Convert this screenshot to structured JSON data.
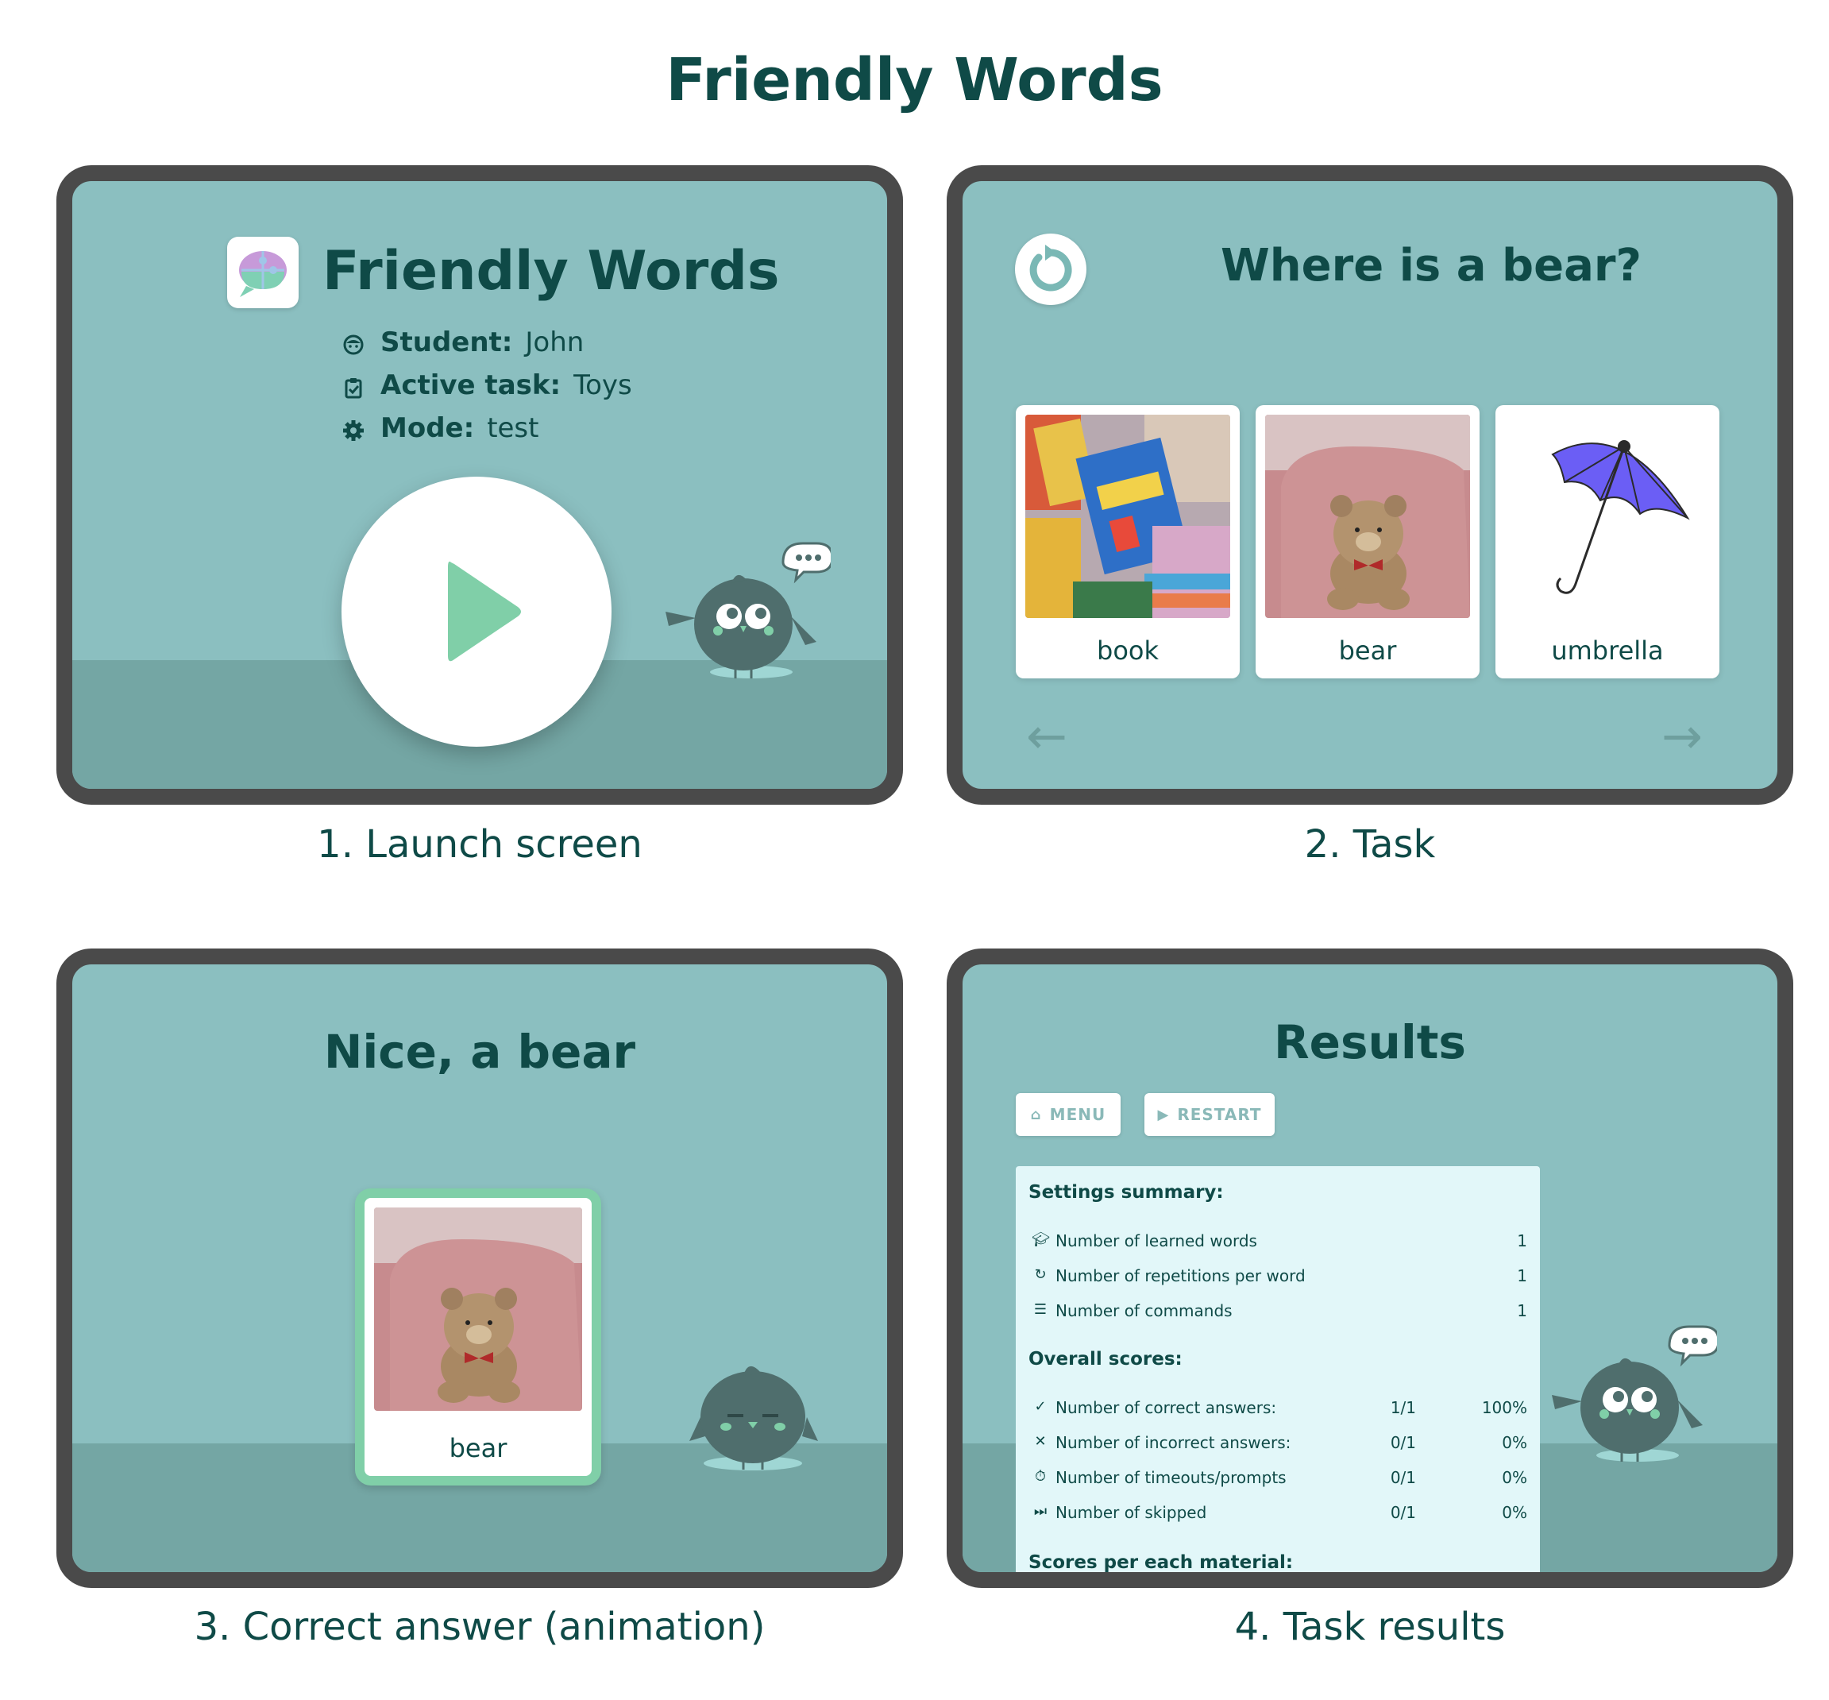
{
  "page_title": "Friendly Words",
  "captions": [
    "1. Launch screen",
    "2. Task",
    "3. Correct answer (animation)",
    "4. Task results"
  ],
  "launch": {
    "app_title": "Friendly Words",
    "student_label": "Student:",
    "student_value": "John",
    "task_label": "Active task:",
    "task_value": "Toys",
    "mode_label": "Mode:",
    "mode_value": "test"
  },
  "task": {
    "question": "Where is a bear?",
    "cards": [
      {
        "label": "book"
      },
      {
        "label": "bear"
      },
      {
        "label": "umbrella"
      }
    ],
    "prev_arrow": "←",
    "next_arrow": "→"
  },
  "correct": {
    "title": "Nice, a bear",
    "card_label": "bear"
  },
  "results": {
    "title": "Results",
    "menu_label": "MENU",
    "restart_label": "RESTART",
    "settings_title": "Settings summary:",
    "settings": [
      {
        "icon": "graduation-cap-icon",
        "label": "Number of learned words",
        "value": "1"
      },
      {
        "icon": "repeat-icon",
        "label": "Number of repetitions per word",
        "value": "1"
      },
      {
        "icon": "list-icon",
        "label": "Number of commands",
        "value": "1"
      }
    ],
    "overall_title": "Overall scores:",
    "scores": [
      {
        "icon": "check-icon",
        "label": "Number of correct answers:",
        "fraction": "1/1",
        "percent": "100%"
      },
      {
        "icon": "x-icon",
        "label": "Number of incorrect answers:",
        "fraction": "0/1",
        "percent": "0%"
      },
      {
        "icon": "timer-icon",
        "label": "Number of timeouts/prompts",
        "fraction": "0/1",
        "percent": "0%"
      },
      {
        "icon": "skip-icon",
        "label": "Number of skipped",
        "fraction": "0/1",
        "percent": "0%"
      }
    ],
    "materials_title": "Scores per each material:"
  },
  "colors": {
    "screen_bg": "#8bbfc0",
    "floor": "#74a6a4",
    "frame": "#4a4a4a",
    "text_dark": "#0f4a47",
    "play_green": "#80cfa8",
    "panel_bg": "#e2f7f9",
    "bird": "#4f6e6d"
  }
}
